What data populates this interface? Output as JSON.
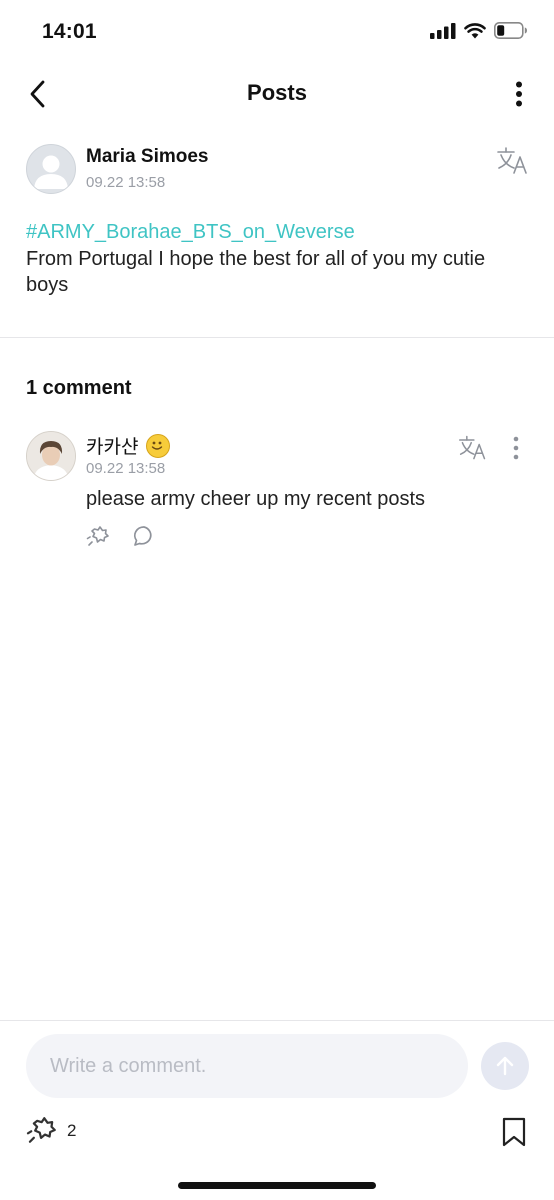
{
  "status_bar": {
    "time": "14:01"
  },
  "header": {
    "title": "Posts"
  },
  "post": {
    "author": "Maria Simoes",
    "timestamp": "09.22 13:58",
    "hashtag": "#ARMY_Borahae_BTS_on_Weverse",
    "body": "From Portugal I hope the best for all of you my cutie boys"
  },
  "comments_section": {
    "count_label": "1 comment",
    "items": [
      {
        "author": "카카샨",
        "timestamp": "09.22 13:58",
        "text": "please army cheer up my recent posts"
      }
    ]
  },
  "bottom_bar": {
    "input_placeholder": "Write a comment.",
    "like_count": "2"
  },
  "colors": {
    "hashtag": "#3fc4c4",
    "muted_text": "#9a9ea6",
    "input_bg": "#f3f4f8",
    "send_bg": "#e5e8f2"
  },
  "icons": [
    "signal-icon",
    "wifi-icon",
    "battery-icon",
    "back-chevron-icon",
    "more-vertical-icon",
    "translate-icon",
    "smile-emoji-icon",
    "cheer-icon",
    "reply-bubble-icon",
    "send-arrow-icon",
    "bookmark-icon"
  ]
}
